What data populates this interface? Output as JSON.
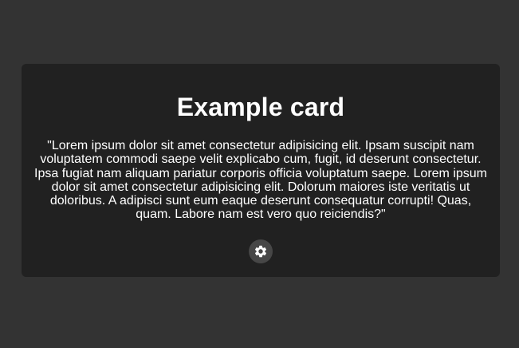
{
  "card": {
    "title": "Example card",
    "text": "\"Lorem ipsum dolor sit amet consectetur adipisicing elit. Ipsam suscipit nam voluptatem commodi saepe velit explicabo cum, fugit, id deserunt consectetur. Ipsa fugiat nam aliquam pariatur corporis officia voluptatum saepe. Lorem ipsum dolor sit amet consectetur adipisicing elit. Dolorum maiores iste veritatis ut doloribus. A adipisci sunt eum eaque deserunt consequatur corrupti! Quas, quam. Labore nam est vero quo reiciendis?\"",
    "button_icon": "gear-icon"
  },
  "colors": {
    "page_background": "#333333",
    "card_background": "#212121",
    "text": "#ffffff",
    "button_background": "#474747"
  }
}
